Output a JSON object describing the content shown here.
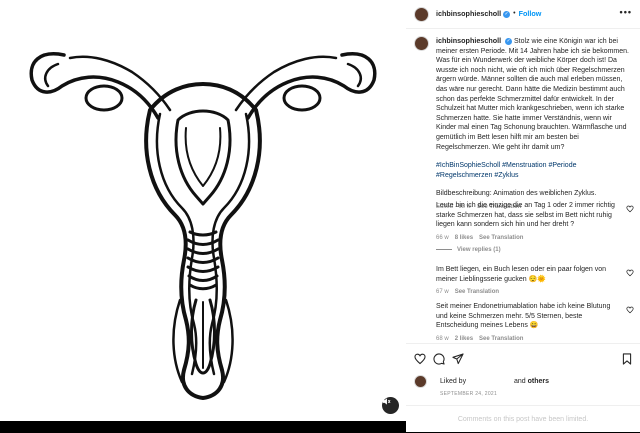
{
  "header": {
    "username": "ichbinsophiescholl",
    "follow_label": "Follow",
    "more_label": "•••"
  },
  "caption": {
    "username": "ichbinsophiescholl",
    "text": "Stolz wie eine Königin war ich bei meiner ersten Periode. Mit 14 Jahren habe ich sie bekommen. Was für ein Wunderwerk der weibliche Körper doch ist! Da wusste ich noch nicht, wie oft ich mich über Regelschmerzen ärgern würde. Männer sollten die auch mal erleben müssen, das wäre nur gerecht. Dann hätte die Medizin bestimmt auch schon das perfekte Schmerzmittel dafür entwickelt. In der Schulzeit hat Mutter mich krankgeschrieben, wenn ich starke Schmerzen hatte. Sie hatte immer Verständnis, wenn wir Kinder mal einen Tag Schonung brauchten. Wärmflasche und gemütlich im Bett lesen hilft mir am besten bei Regelschmerzen. Wie geht ihr damit um?",
    "hashtags": "#IchBinSophieScholl #Menstruation #Periode #Regelschmerzen #Zyklus",
    "description": "Bildbeschreibung: Animation des weiblichen Zyklus.",
    "meta": "Edited · 68 w",
    "see_translation": "See Translation"
  },
  "comments": [
    {
      "text": "Leute bin ich die einzige die an Tag 1 oder 2 immer richtig starke Schmerzen hat, dass sie selbst im Bett nicht ruhig liegen kann sondern sich hin und her dreht ?",
      "age": "66 w",
      "likes": "8 likes",
      "see_translation": "See Translation"
    },
    {
      "text": "Im Bett liegen, ein Buch lesen oder ein paar folgen von meiner Lieblingsserie gucken 😌🌞",
      "age": "67 w",
      "see_translation": "See Translation"
    },
    {
      "text": "Seit meiner Endonetriumablation habe ich keine Blutung und keine Schmerzen mehr. 5/5 Sternen, beste Entscheidung meines Lebens 😄",
      "age": "68 w",
      "likes": "2 likes",
      "see_translation": "See Translation"
    }
  ],
  "view_replies": "View replies (1)",
  "likes": {
    "prefix": "Liked by",
    "suffix": "and",
    "others": "others"
  },
  "date": "SEPTEMBER 24, 2021",
  "comments_limited": "Comments on this post have been limited."
}
